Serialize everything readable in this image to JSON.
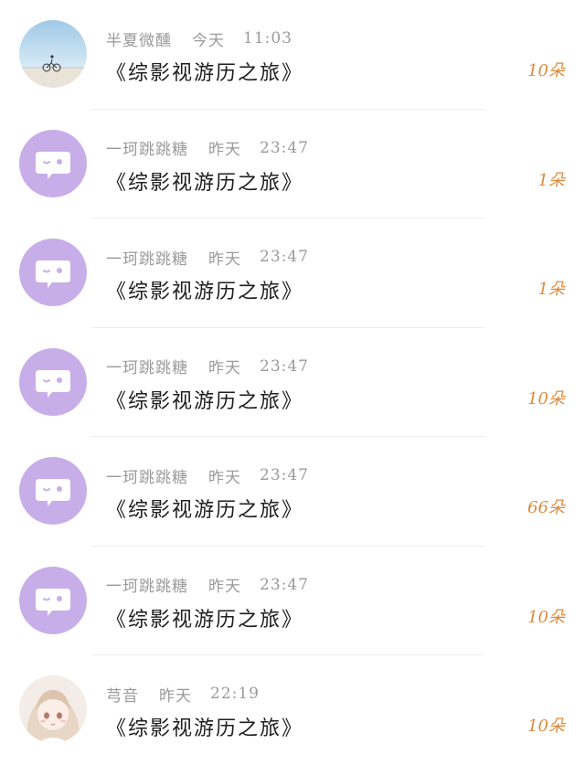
{
  "rows": [
    {
      "avatar": "scenic-photo-avatar",
      "name": "半夏微醺",
      "day": "今天",
      "time": "11:03",
      "title": "《综影视游历之旅》",
      "amount": "10朵"
    },
    {
      "avatar": "default-chat-avatar",
      "name": "一珂跳跳糖",
      "day": "昨天",
      "time": "23:47",
      "title": "《综影视游历之旅》",
      "amount": "1朵"
    },
    {
      "avatar": "default-chat-avatar",
      "name": "一珂跳跳糖",
      "day": "昨天",
      "time": "23:47",
      "title": "《综影视游历之旅》",
      "amount": "1朵"
    },
    {
      "avatar": "default-chat-avatar",
      "name": "一珂跳跳糖",
      "day": "昨天",
      "time": "23:47",
      "title": "《综影视游历之旅》",
      "amount": "10朵"
    },
    {
      "avatar": "default-chat-avatar",
      "name": "一珂跳跳糖",
      "day": "昨天",
      "time": "23:47",
      "title": "《综影视游历之旅》",
      "amount": "66朵"
    },
    {
      "avatar": "default-chat-avatar",
      "name": "一珂跳跳糖",
      "day": "昨天",
      "time": "23:47",
      "title": "《综影视游历之旅》",
      "amount": "10朵"
    },
    {
      "avatar": "anime-girl-avatar",
      "name": "芎音",
      "day": "昨天",
      "time": "22:19",
      "title": "《综影视游历之旅》",
      "amount": "10朵"
    }
  ],
  "colors": {
    "default_avatar_bg": "#c8aee8",
    "amount": "#dc8a3c",
    "meta": "#9a9a9a",
    "title": "#1e1e1e"
  }
}
